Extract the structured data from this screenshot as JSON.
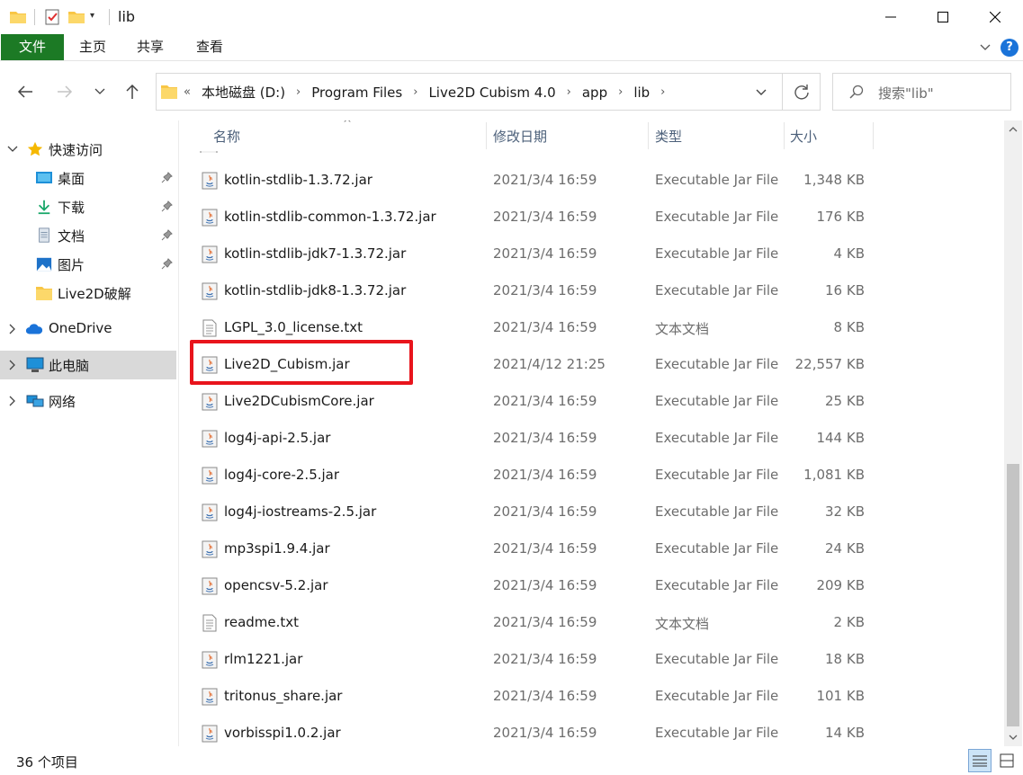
{
  "window": {
    "title": "lib",
    "accent": "#1c7a25"
  },
  "ribbon": {
    "tabs": [
      {
        "label": "文件"
      },
      {
        "label": "主页"
      },
      {
        "label": "共享"
      },
      {
        "label": "查看"
      }
    ],
    "help_label": "?"
  },
  "address": {
    "crumbs": [
      "本地磁盘 (D:)",
      "Program Files",
      "Live2D Cubism 4.0",
      "app",
      "lib"
    ]
  },
  "search": {
    "placeholder": "搜索\"lib\""
  },
  "sidebar": {
    "items": [
      {
        "label": "快速访问",
        "icon": "star-icon"
      },
      {
        "label": "桌面",
        "icon": "desktop-icon",
        "pinned": true
      },
      {
        "label": "下载",
        "icon": "download-icon",
        "pinned": true
      },
      {
        "label": "文档",
        "icon": "document-icon",
        "pinned": true
      },
      {
        "label": "图片",
        "icon": "pictures-icon",
        "pinned": true
      },
      {
        "label": "Live2D破解",
        "icon": "folder-icon"
      },
      {
        "label": "OneDrive",
        "icon": "cloud-icon"
      },
      {
        "label": "此电脑",
        "icon": "computer-icon",
        "selected": true
      },
      {
        "label": "网络",
        "icon": "network-icon"
      }
    ]
  },
  "columns": {
    "name": "名称",
    "date": "修改日期",
    "type": "类型",
    "size": "大小"
  },
  "files": [
    {
      "name": "kotlin-stdlib-1.3.72.jar",
      "date": "2021/3/4 16:59",
      "type": "Executable Jar File",
      "size": "1,348 KB",
      "kind": "jar"
    },
    {
      "name": "kotlin-stdlib-common-1.3.72.jar",
      "date": "2021/3/4 16:59",
      "type": "Executable Jar File",
      "size": "176 KB",
      "kind": "jar"
    },
    {
      "name": "kotlin-stdlib-jdk7-1.3.72.jar",
      "date": "2021/3/4 16:59",
      "type": "Executable Jar File",
      "size": "4 KB",
      "kind": "jar"
    },
    {
      "name": "kotlin-stdlib-jdk8-1.3.72.jar",
      "date": "2021/3/4 16:59",
      "type": "Executable Jar File",
      "size": "16 KB",
      "kind": "jar"
    },
    {
      "name": "LGPL_3.0_license.txt",
      "date": "2021/3/4 16:59",
      "type": "文本文档",
      "size": "8 KB",
      "kind": "txt"
    },
    {
      "name": "Live2D_Cubism.jar",
      "date": "2021/4/12 21:25",
      "type": "Executable Jar File",
      "size": "22,557 KB",
      "kind": "jar"
    },
    {
      "name": "Live2DCubismCore.jar",
      "date": "2021/3/4 16:59",
      "type": "Executable Jar File",
      "size": "25 KB",
      "kind": "jar"
    },
    {
      "name": "log4j-api-2.5.jar",
      "date": "2021/3/4 16:59",
      "type": "Executable Jar File",
      "size": "144 KB",
      "kind": "jar"
    },
    {
      "name": "log4j-core-2.5.jar",
      "date": "2021/3/4 16:59",
      "type": "Executable Jar File",
      "size": "1,081 KB",
      "kind": "jar"
    },
    {
      "name": "log4j-iostreams-2.5.jar",
      "date": "2021/3/4 16:59",
      "type": "Executable Jar File",
      "size": "32 KB",
      "kind": "jar"
    },
    {
      "name": "mp3spi1.9.4.jar",
      "date": "2021/3/4 16:59",
      "type": "Executable Jar File",
      "size": "24 KB",
      "kind": "jar"
    },
    {
      "name": "opencsv-5.2.jar",
      "date": "2021/3/4 16:59",
      "type": "Executable Jar File",
      "size": "209 KB",
      "kind": "jar"
    },
    {
      "name": "readme.txt",
      "date": "2021/3/4 16:59",
      "type": "文本文档",
      "size": "2 KB",
      "kind": "txt"
    },
    {
      "name": "rlm1221.jar",
      "date": "2021/3/4 16:59",
      "type": "Executable Jar File",
      "size": "18 KB",
      "kind": "jar"
    },
    {
      "name": "tritonus_share.jar",
      "date": "2021/3/4 16:59",
      "type": "Executable Jar File",
      "size": "101 KB",
      "kind": "jar"
    },
    {
      "name": "vorbisspi1.0.2.jar",
      "date": "2021/3/4 16:59",
      "type": "Executable Jar File",
      "size": "14 KB",
      "kind": "jar"
    }
  ],
  "status": {
    "item_count": "36 个项目"
  },
  "colors": {
    "highlight": "#e8141c",
    "selected_nav": "#d9d9d9",
    "header_text": "#4c607a"
  }
}
